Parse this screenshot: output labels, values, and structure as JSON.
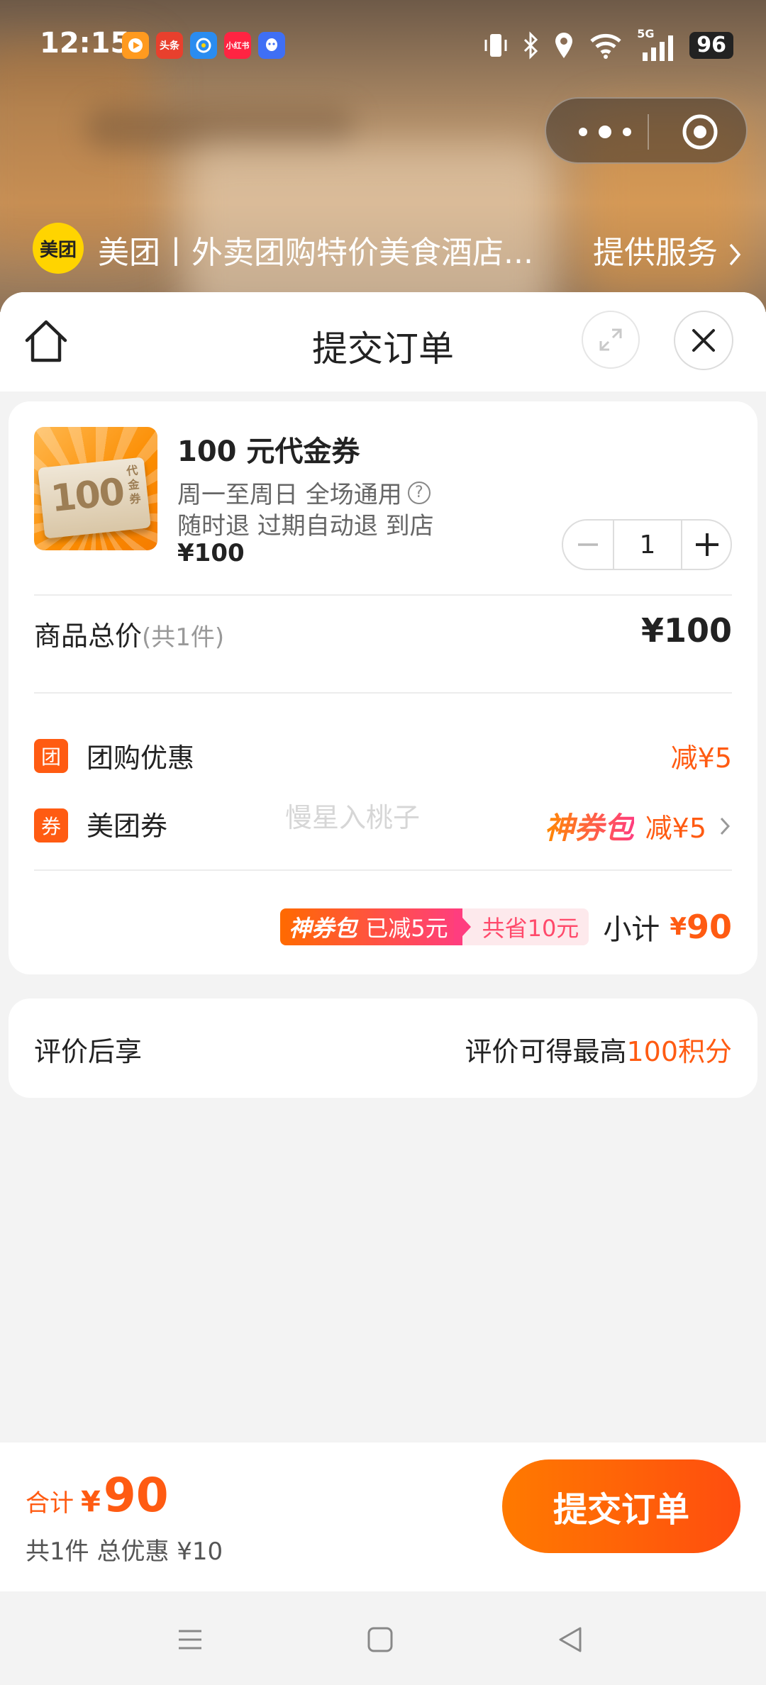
{
  "status_bar": {
    "time": "12:15",
    "apps": [
      {
        "name": "video-app-icon",
        "color": "#ff8a00",
        "label": ""
      },
      {
        "name": "toutiao-app-icon",
        "color": "#e8402d",
        "label": "头条"
      },
      {
        "name": "qq-browser-app-icon",
        "color": "#2a8cf0",
        "label": ""
      },
      {
        "name": "xiaohongshu-app-icon",
        "color": "#ff2442",
        "label": "小红书"
      },
      {
        "name": "qq-app-icon",
        "color": "#3f6ff5",
        "label": ""
      }
    ],
    "network": "5G",
    "battery": "96"
  },
  "merchant": {
    "logo_text": "美团",
    "name": "美团丨外卖团购特价美食酒店...",
    "service_link": "提供服务"
  },
  "sheet": {
    "title": "提交订单"
  },
  "product": {
    "title": "100 元代金券",
    "desc_line1": "周一至周日 全场通用",
    "desc_line2": "随时退 过期自动退 到店",
    "price": "¥100",
    "thumbnail_number": "100",
    "thumbnail_tag": "代金券",
    "quantity": "1"
  },
  "summary": {
    "total_label": "商品总价",
    "total_count": "(共1件)",
    "total_value": "¥100"
  },
  "discounts": [
    {
      "badge": "团",
      "label": "团购优惠",
      "value": "减¥5"
    },
    {
      "badge": "券",
      "label": "美团券",
      "value": "减¥5",
      "promo_brand": "神券包"
    }
  ],
  "watermark": "慢星入桃子",
  "subtotal": {
    "promo_brand": "神券包",
    "promo_reduced": "已减5元",
    "promo_saved": "共省10元",
    "label": "小计",
    "currency": "¥",
    "value": "90"
  },
  "review": {
    "label": "评价后享",
    "text": "评价可得最高",
    "highlight": "100积分"
  },
  "footer": {
    "total_label": "合计",
    "currency": "¥",
    "total_value": "90",
    "summary": "共1件 总优惠 ¥10",
    "submit_label": "提交订单"
  },
  "colors": {
    "accent": "#ff5b12",
    "brand_yellow": "#ffd400"
  }
}
